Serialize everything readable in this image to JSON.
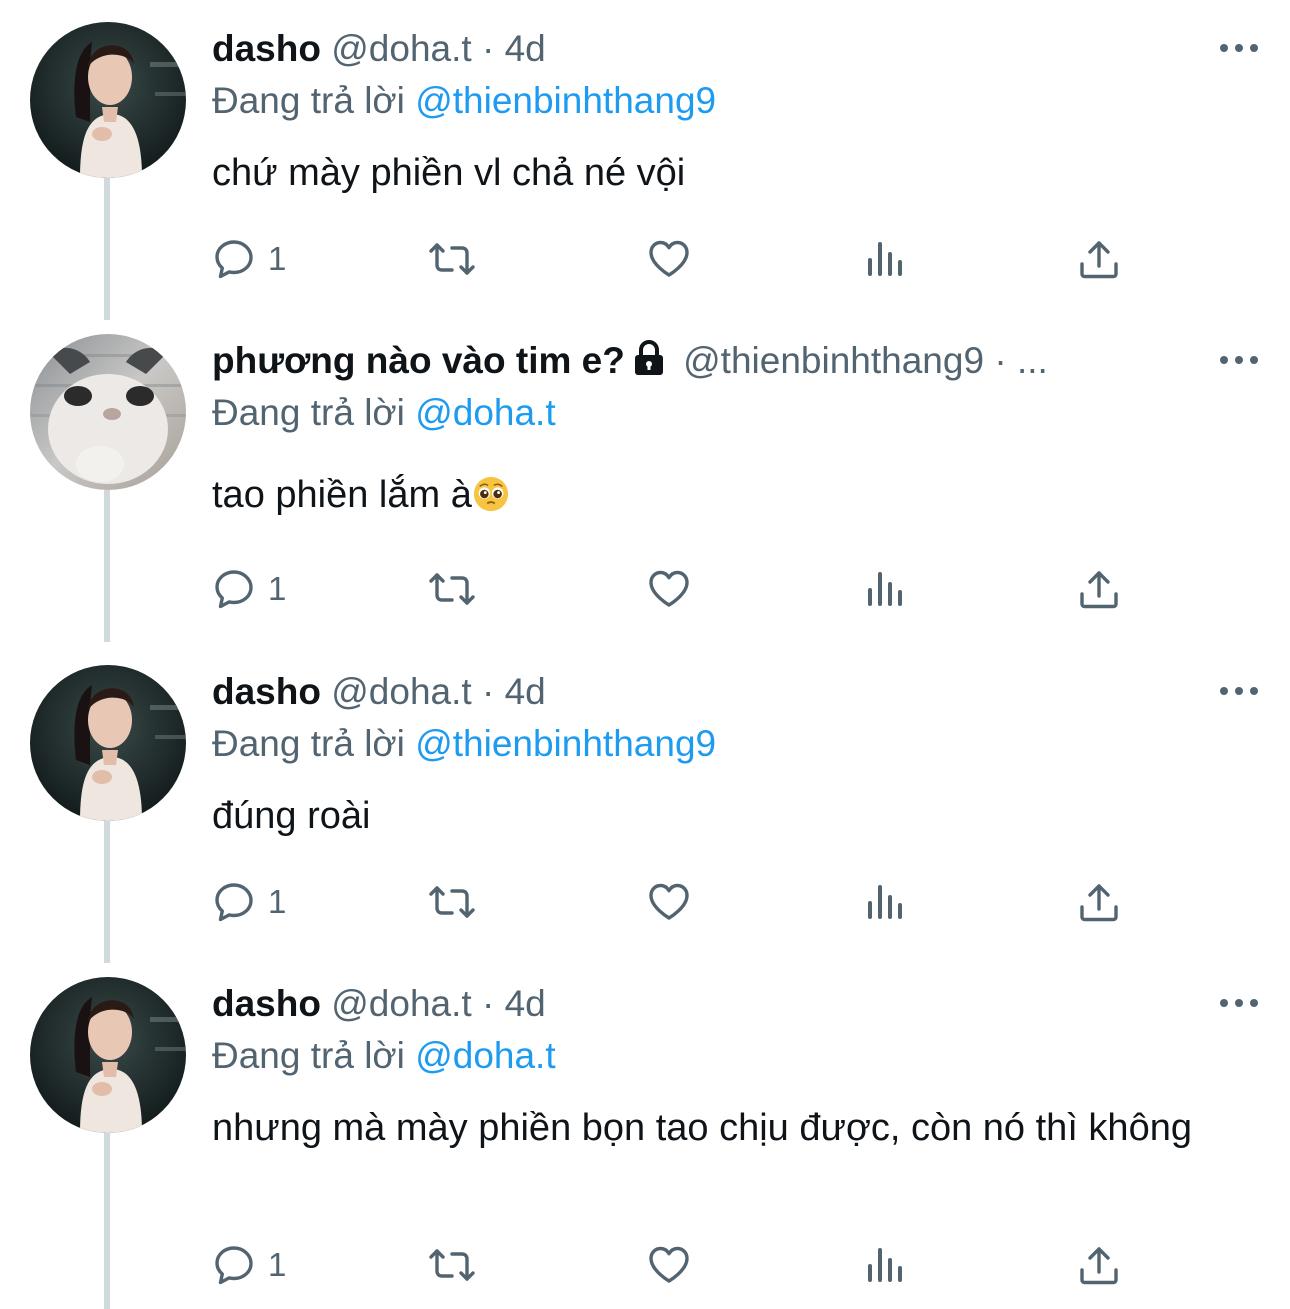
{
  "colors": {
    "link": "#1d9bf0",
    "secondary_text": "#536471",
    "primary_text": "#0f1419",
    "thread_line": "#cfd9de"
  },
  "icons": {
    "reply": "reply-icon",
    "retweet": "retweet-icon",
    "like": "heart-icon",
    "views": "views-icon",
    "share": "share-icon",
    "more": "more-icon",
    "lock": "lock-icon"
  },
  "tweets": [
    {
      "name": "dasho",
      "handle": "@doha.t",
      "separator": "·",
      "time": "4d",
      "reply_prefix": "Đang trả lời",
      "reply_to": "@thienbinhthang9",
      "text": "chứ mày phiền vl chả né vội",
      "reply_count": "1",
      "avatar": "girl"
    },
    {
      "name": "phương nào vào tim e?",
      "handle": "@thienbinhthang9",
      "separator": "·",
      "time": "...",
      "protected": true,
      "reply_prefix": "Đang trả lời",
      "reply_to": "@doha.t",
      "text": "tao phiền lắm à",
      "text_emoji": "pleading-face",
      "reply_count": "1",
      "avatar": "cat"
    },
    {
      "name": "dasho",
      "handle": "@doha.t",
      "separator": "·",
      "time": "4d",
      "reply_prefix": "Đang trả lời",
      "reply_to": "@thienbinhthang9",
      "text": "đúng roài",
      "reply_count": "1",
      "avatar": "girl"
    },
    {
      "name": "dasho",
      "handle": "@doha.t",
      "separator": "·",
      "time": "4d",
      "reply_prefix": "Đang trả lời",
      "reply_to": "@doha.t",
      "text": "nhưng mà mày phiền bọn tao chịu được, còn nó thì không",
      "reply_count": "1",
      "avatar": "girl"
    }
  ]
}
